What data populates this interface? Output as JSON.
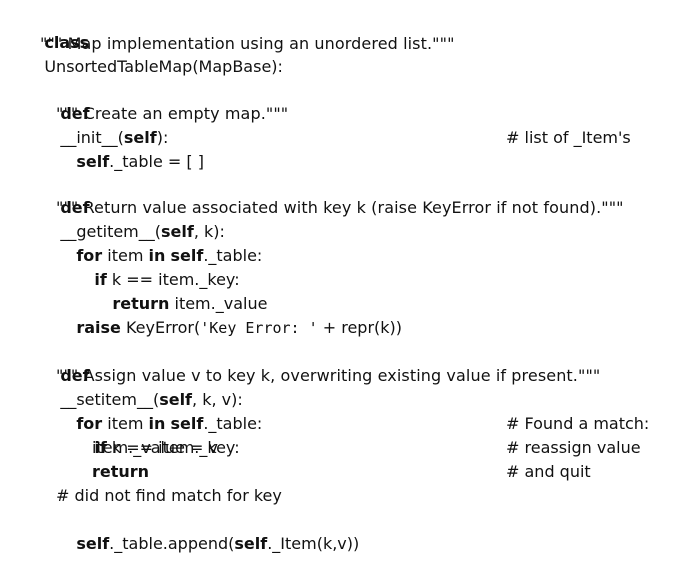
{
  "code": {
    "class_kw": "class",
    "class_sig": "UnsortedTableMap(MapBase):",
    "class_doc": "\"\"\" Map implementation using an unordered list.\"\"\"",
    "init_def_kw": "def",
    "init_name": "__init__(",
    "init_self": "self",
    "init_close": "):",
    "init_doc": "\"\"\" Create an empty map.\"\"\"",
    "init_body_self": "self",
    "init_body_rest": "._table = [ ]",
    "init_comment": "# list of _Item's",
    "get_def_kw": "def",
    "get_name": "__getitem__(",
    "get_self": "self",
    "get_rest": ", k):",
    "get_doc": "\"\"\" Return value associated with key k (raise KeyError if not found).\"\"\"",
    "get_for_kw": "for",
    "get_for_item": " item ",
    "get_in_kw": "in",
    "get_for_space": " ",
    "get_for_self": "self",
    "get_for_rest": "._table:",
    "get_if_kw": "if",
    "get_if_rest": " k == item._key:",
    "get_return_kw": "return",
    "get_return_rest": " item._value",
    "get_raise_kw": "raise",
    "get_raise_pre": " KeyError(",
    "get_raise_str": "'Key Error: '",
    "get_raise_post": " + repr(k))",
    "set_def_kw": "def",
    "set_name": "__setitem__(",
    "set_self": "self",
    "set_rest": ", k, v):",
    "set_doc": "\"\"\" Assign value v to key k, overwriting existing value if present.\"\"\"",
    "set_for_kw": "for",
    "set_for_item": " item ",
    "set_in_kw": "in",
    "set_for_space": " ",
    "set_for_self": "self",
    "set_for_rest": "._table:",
    "set_if_kw": "if",
    "set_if_rest": " k == item._key:",
    "set_if_comment": "# Found a match:",
    "set_assign": "item._value = v",
    "set_assign_comment": "# reassign value",
    "set_return_kw": "return",
    "set_return_comment": "# and quit",
    "set_nomatch_comment": "# did not find match for key",
    "set_append_self": "self",
    "set_append_mid": "._table.append(",
    "set_append_self2": "self",
    "set_append_rest": "._Item(k,v))"
  }
}
